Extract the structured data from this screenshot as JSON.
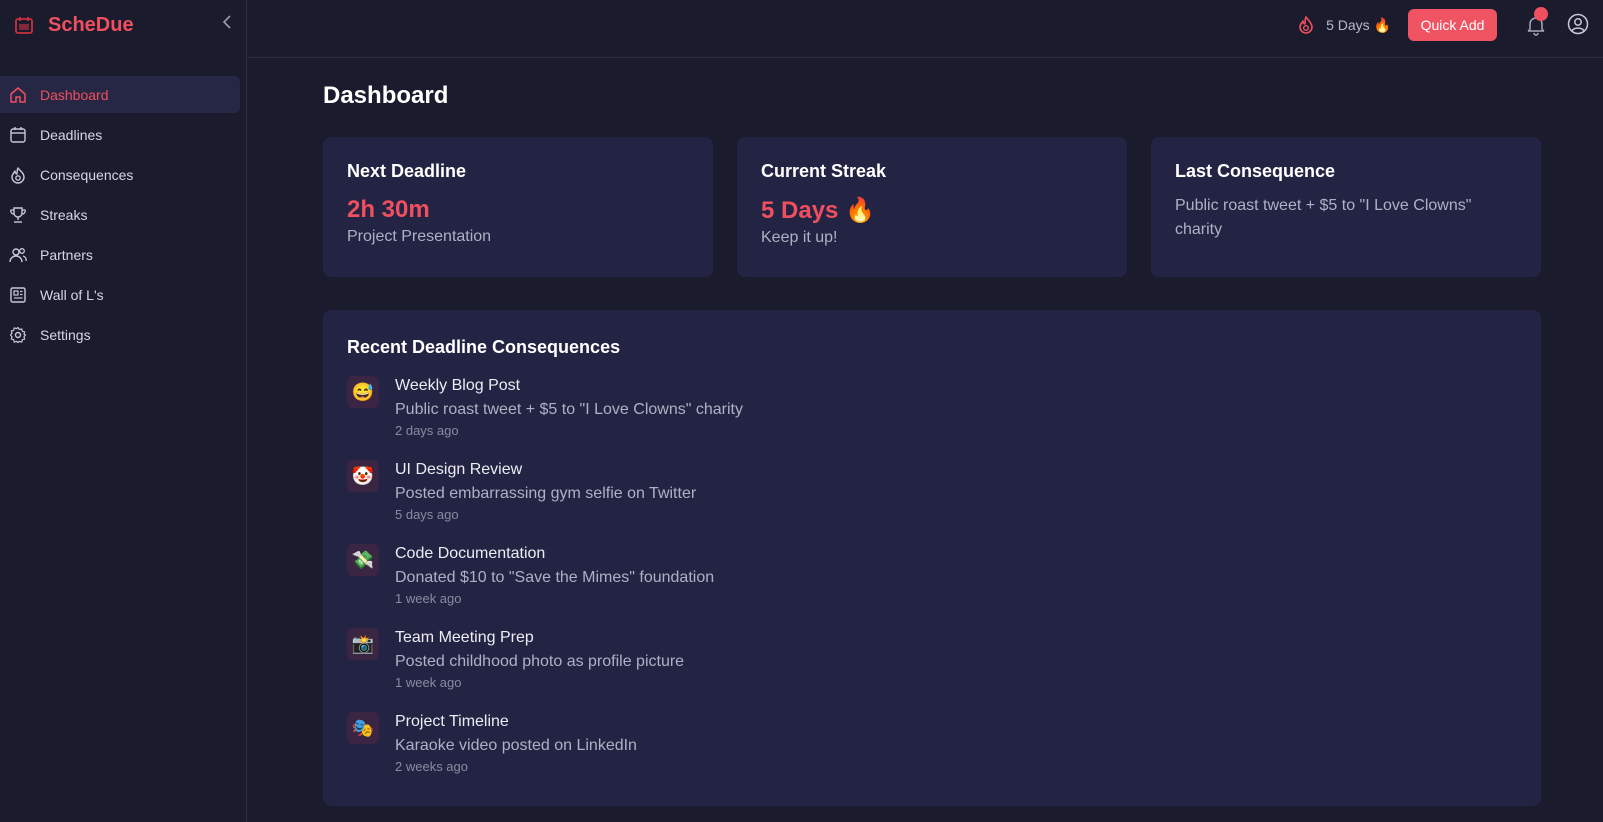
{
  "app": {
    "name": "ScheDue"
  },
  "colors": {
    "accent": "#ef4f5e",
    "background": "#1b1b2e",
    "card": "#232443"
  },
  "sidebar": {
    "items": [
      {
        "label": "Dashboard",
        "icon": "home-icon",
        "active": true
      },
      {
        "label": "Deadlines",
        "icon": "calendar-icon"
      },
      {
        "label": "Consequences",
        "icon": "flame-icon"
      },
      {
        "label": "Streaks",
        "icon": "trophy-icon"
      },
      {
        "label": "Partners",
        "icon": "users-icon"
      },
      {
        "label": "Wall of L's",
        "icon": "newspaper-icon"
      },
      {
        "label": "Settings",
        "icon": "gear-icon"
      }
    ]
  },
  "header": {
    "streak_label": "5 Days 🔥",
    "quick_add_label": "Quick Add"
  },
  "page": {
    "title": "Dashboard"
  },
  "cards": {
    "next_deadline": {
      "title": "Next Deadline",
      "value": "2h 30m",
      "subtitle": "Project Presentation"
    },
    "current_streak": {
      "title": "Current Streak",
      "value": "5 Days 🔥",
      "subtitle": "Keep it up!"
    },
    "last_consequence": {
      "title": "Last Consequence",
      "text": "Public roast tweet + $5 to \"I Love Clowns\" charity"
    }
  },
  "recent": {
    "title": "Recent Deadline Consequences",
    "items": [
      {
        "emoji": "😅",
        "title": "Weekly Blog Post",
        "description": "Public roast tweet + $5 to \"I Love Clowns\" charity",
        "time": "2 days ago"
      },
      {
        "emoji": "🤡",
        "title": "UI Design Review",
        "description": "Posted embarrassing gym selfie on Twitter",
        "time": "5 days ago"
      },
      {
        "emoji": "💸",
        "title": "Code Documentation",
        "description": "Donated $10 to \"Save the Mimes\" foundation",
        "time": "1 week ago"
      },
      {
        "emoji": "📸",
        "title": "Team Meeting Prep",
        "description": "Posted childhood photo as profile picture",
        "time": "1 week ago"
      },
      {
        "emoji": "🎭",
        "title": "Project Timeline",
        "description": "Karaoke video posted on LinkedIn",
        "time": "2 weeks ago"
      }
    ]
  }
}
